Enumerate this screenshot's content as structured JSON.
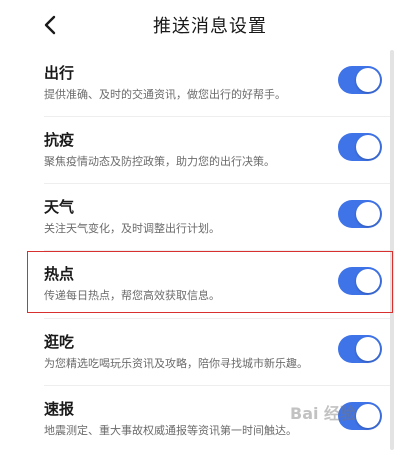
{
  "header": {
    "title": "推送消息设置"
  },
  "items": [
    {
      "title": "出行",
      "desc": "提供准确、及时的交通资讯，做您出行的好帮手。",
      "enabled": true
    },
    {
      "title": "抗疫",
      "desc": "聚焦疫情动态及防控政策，助力您的出行决策。",
      "enabled": true
    },
    {
      "title": "天气",
      "desc": "关注天气变化，及时调整出行计划。",
      "enabled": true
    },
    {
      "title": "热点",
      "desc": "传递每日热点，帮您高效获取信息。",
      "enabled": true
    },
    {
      "title": "逛吃",
      "desc": "为您精选吃喝玩乐资讯及攻略，陪你寻找城市新乐趣。",
      "enabled": true
    },
    {
      "title": "速报",
      "desc": "地震测定、重大事故权威通报等资讯第一时间触达。",
      "enabled": true
    }
  ],
  "colors": {
    "toggle_on": "#3f73e8",
    "highlight": "#d8302f"
  },
  "watermark": "Bai 经验"
}
